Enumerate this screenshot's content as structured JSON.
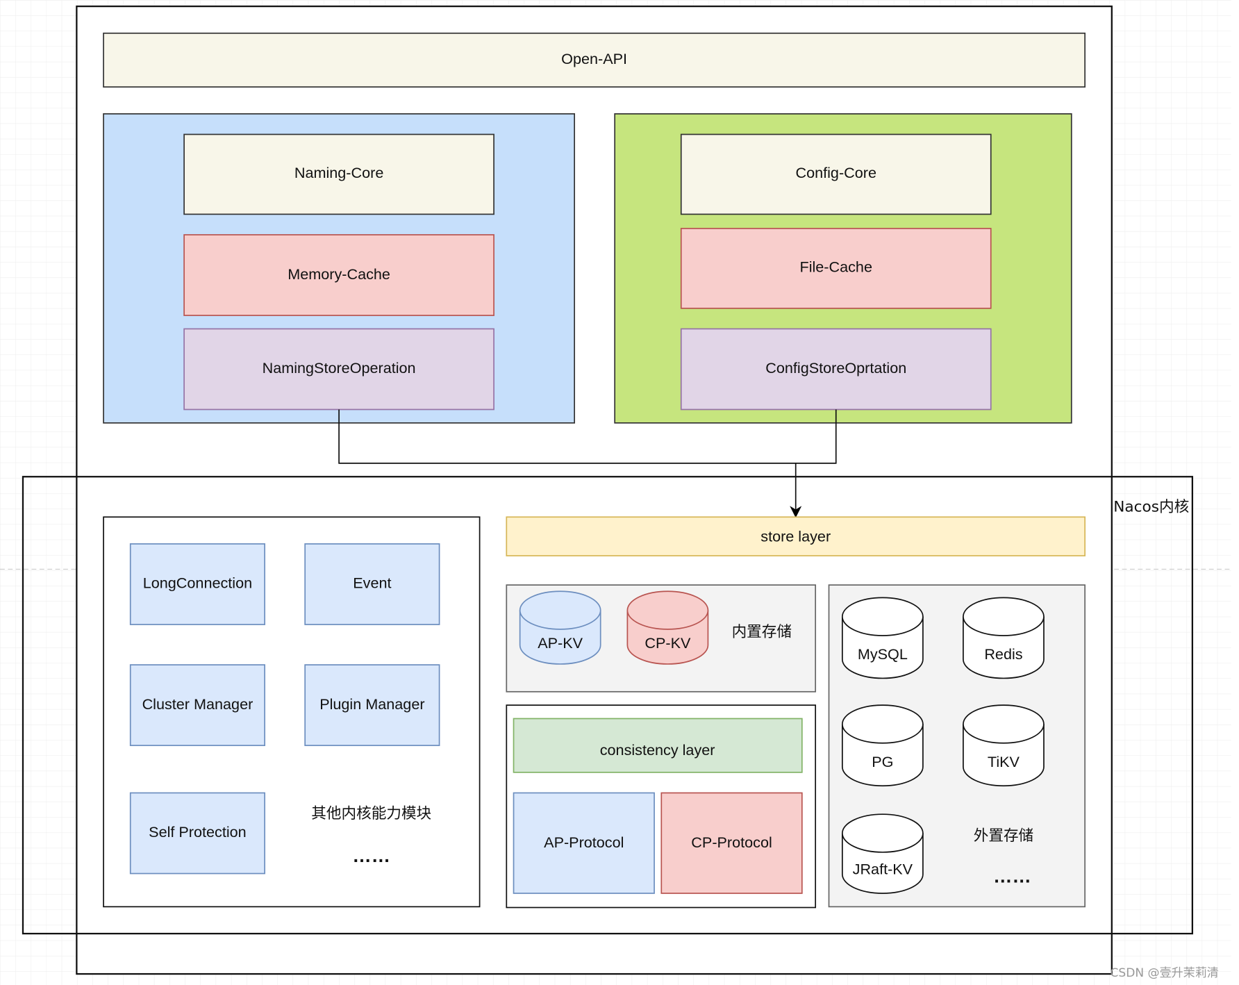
{
  "open_api": "Open-API",
  "naming": {
    "core": "Naming-Core",
    "cache": "Memory-Cache",
    "store": "NamingStoreOperation"
  },
  "config": {
    "core": "Config-Core",
    "cache": "File-Cache",
    "store": "ConfigStoreOprtation"
  },
  "kernel": {
    "label": "Nacos内核",
    "modules": [
      "LongConnection",
      "Event",
      "Cluster Manager",
      "Plugin Manager",
      "Self Protection"
    ],
    "other_modules": "其他内核能力模块",
    "other_ellipsis": "……",
    "store_layer": "store layer",
    "builtin": {
      "label": "内置存储",
      "items": [
        "AP-KV",
        "CP-KV"
      ]
    },
    "consistency": {
      "layer": "consistency layer",
      "protocols": [
        "AP-Protocol",
        "CP-Protocol"
      ]
    },
    "external": {
      "label": "外置存储",
      "items": [
        "MySQL",
        "Redis",
        "PG",
        "TiKV",
        "JRaft-KV"
      ],
      "ellipsis": "……"
    }
  },
  "watermark": "CSDN @壹升茉莉清",
  "colors": {
    "beige": "#f8f6e9",
    "blue_container": "#c6dffb",
    "green_container": "#c6e57e",
    "red": "#f8cecc",
    "purple": "#e1d5e7",
    "light_blue": "#dae8fc",
    "yellow": "#fff2cc",
    "green": "#d5e8d4",
    "gray": "#f3f3f3"
  }
}
